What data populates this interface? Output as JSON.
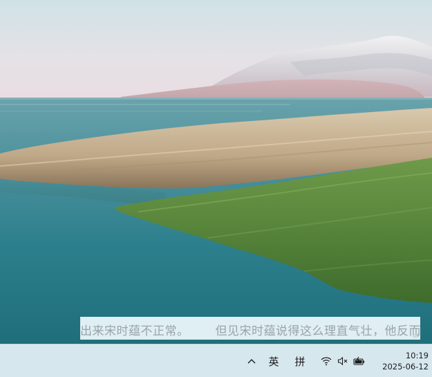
{
  "ticker": {
    "text_part1": "出来宋时蕴不正常。",
    "text_part2": "但见宋时蕴说得这么理直气壮，他反而"
  },
  "tray": {
    "overflow_icon": "chevron-up-icon",
    "input_language": "英",
    "input_mode": "拼",
    "network_icon": "wifi-icon",
    "volume_icon": "speaker-muted-icon",
    "battery_icon": "battery-charging-icon"
  },
  "clock": {
    "time": "10:19",
    "date": "2025-06-12"
  }
}
